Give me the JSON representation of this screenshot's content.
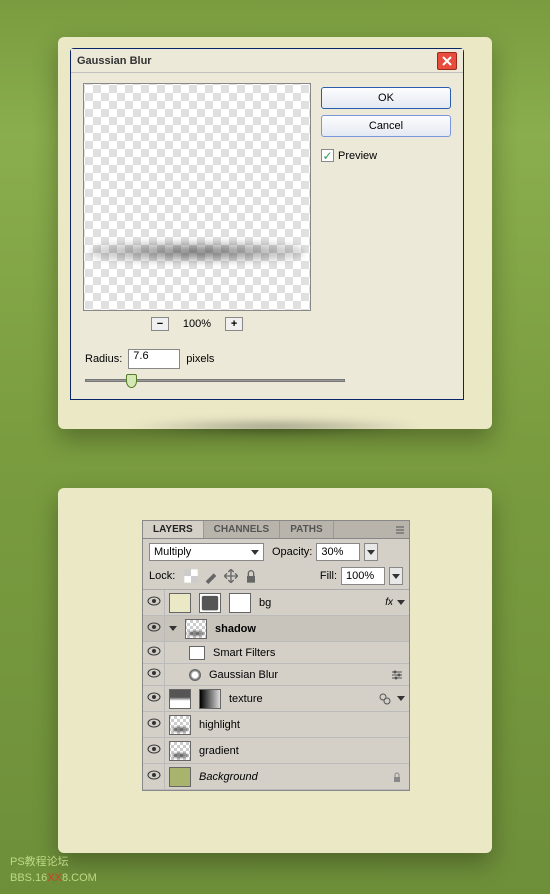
{
  "dialog": {
    "title": "Gaussian Blur",
    "ok_label": "OK",
    "cancel_label": "Cancel",
    "preview_label": "Preview",
    "zoom_value": "100%",
    "radius_label": "Radius:",
    "radius_value": "7.6",
    "radius_unit": "pixels"
  },
  "layers_panel": {
    "tabs": {
      "layers": "LAYERS",
      "channels": "CHANNELS",
      "paths": "PATHS"
    },
    "blend_mode": "Multiply",
    "opacity_label": "Opacity:",
    "opacity_value": "30%",
    "lock_label": "Lock:",
    "fill_label": "Fill:",
    "fill_value": "100%",
    "layers": {
      "bg": "bg",
      "shadow": "shadow",
      "smart_filters": "Smart Filters",
      "gaussian_blur": "Gaussian Blur",
      "texture": "texture",
      "highlight": "highlight",
      "gradient": "gradient",
      "background": "Background"
    }
  },
  "watermark": {
    "line1": "PS教程论坛",
    "line2a": "BBS.16",
    "line2b": "XX",
    "line2c": "8.COM"
  }
}
